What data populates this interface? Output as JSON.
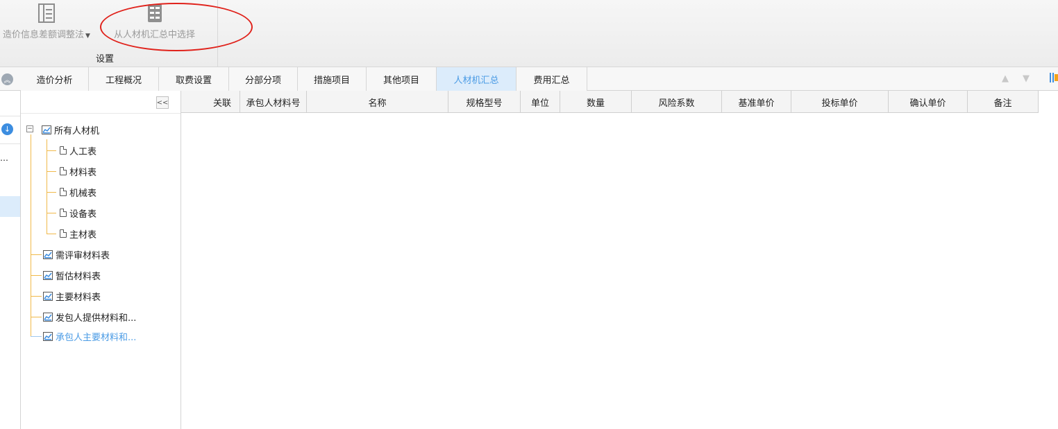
{
  "ribbon": {
    "buttons": [
      {
        "label": "造价信息差额调整法",
        "icon": "table-adjust-icon"
      },
      {
        "label": "从人材机汇总中选择",
        "icon": "select-list-icon"
      }
    ],
    "group_label": "设置"
  },
  "tabs": [
    "造价分析",
    "工程概况",
    "取费设置",
    "分部分项",
    "措施项目",
    "其他项目",
    "人材机汇总",
    "费用汇总"
  ],
  "active_tab": "人材机汇总",
  "left_strip": {
    "dots": "…"
  },
  "tree": {
    "collapse_label": "<<",
    "root": "所有人材机",
    "children": [
      "人工表",
      "材料表",
      "机械表",
      "设备表",
      "主材表"
    ],
    "siblings": [
      "需评审材料表",
      "暂估材料表",
      "主要材料表",
      "发包人提供材料和...",
      "承包人主要材料和..."
    ],
    "selected": "承包人主要材料和..."
  },
  "grid": {
    "columns": [
      "关联",
      "承包人材料号",
      "名称",
      "规格型号",
      "单位",
      "数量",
      "风险系数",
      "基准单价",
      "投标单价",
      "确认单价",
      "备注"
    ]
  },
  "colors": {
    "accent": "#4a9be5",
    "annotation": "#e0221b",
    "tree_line": "#f0b94a"
  }
}
